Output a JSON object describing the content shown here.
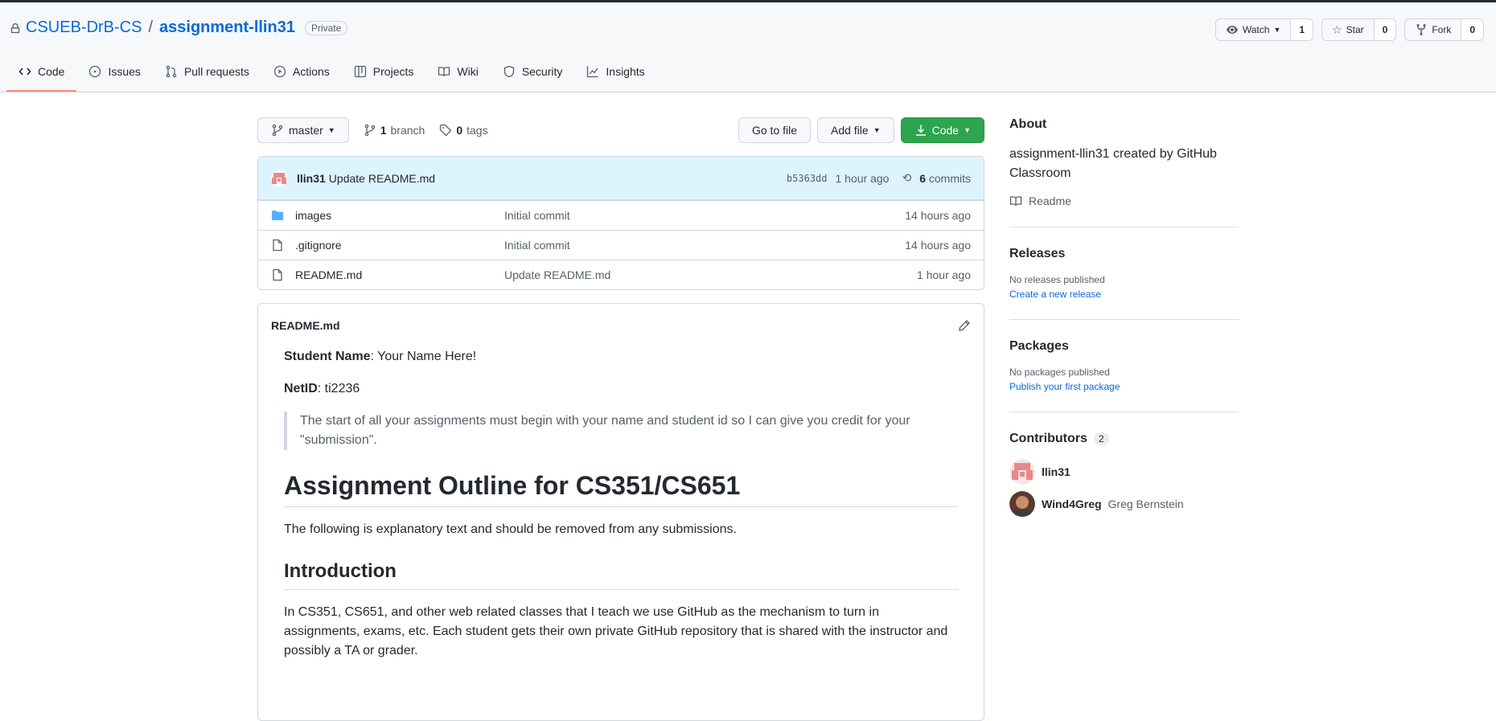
{
  "repo": {
    "owner": "CSUEB-DrB-CS",
    "separator": "/",
    "name": "assignment-llin31",
    "visibility": "Private"
  },
  "actions": {
    "watch_label": "Watch",
    "watch_count": "1",
    "star_label": "Star",
    "star_count": "0",
    "fork_label": "Fork",
    "fork_count": "0"
  },
  "tabs": [
    {
      "label": "Code",
      "icon": "code-icon"
    },
    {
      "label": "Issues",
      "icon": "issue-icon"
    },
    {
      "label": "Pull requests",
      "icon": "pull-request-icon"
    },
    {
      "label": "Actions",
      "icon": "play-icon"
    },
    {
      "label": "Projects",
      "icon": "table-icon"
    },
    {
      "label": "Wiki",
      "icon": "book-icon"
    },
    {
      "label": "Security",
      "icon": "shield-icon"
    },
    {
      "label": "Insights",
      "icon": "graph-icon"
    }
  ],
  "filebar": {
    "branch": "master",
    "branch_count": "1",
    "branch_word": "branch",
    "tag_count": "0",
    "tag_word": "tags",
    "goto_file": "Go to file",
    "add_file": "Add file",
    "code": "Code"
  },
  "commit": {
    "author": "llin31",
    "message": "Update README.md",
    "sha": "b5363dd",
    "age": "1 hour ago",
    "count": "6",
    "count_word": "commits"
  },
  "files": [
    {
      "type": "folder",
      "name": "images",
      "message": "Initial commit",
      "age": "14 hours ago"
    },
    {
      "type": "file",
      "name": ".gitignore",
      "message": "Initial commit",
      "age": "14 hours ago"
    },
    {
      "type": "file",
      "name": "README.md",
      "message": "Update README.md",
      "age": "1 hour ago"
    }
  ],
  "readme": {
    "filename": "README.md",
    "student_label": "Student Name",
    "student_value": ": Your Name Here!",
    "netid_label": "NetID",
    "netid_value": ": ti2236",
    "quote": "The start of all your assignments must begin with your name and student id so I can give you credit for your \"submission\".",
    "h1": "Assignment Outline for CS351/CS651",
    "p1": "The following is explanatory text and should be removed from any submissions.",
    "h2": "Introduction",
    "p2": "In CS351, CS651, and other web related classes that I teach we use GitHub as the mechanism to turn in assignments, exams, etc. Each student gets their own private GitHub repository that is shared with the instructor and possibly a TA or grader."
  },
  "sidebar": {
    "about_title": "About",
    "about_desc": "assignment-llin31 created by GitHub Classroom",
    "readme_link": "Readme",
    "releases_title": "Releases",
    "releases_none": "No releases published",
    "releases_link": "Create a new release",
    "packages_title": "Packages",
    "packages_none": "No packages published",
    "packages_link": "Publish your first package",
    "contributors_title": "Contributors",
    "contributors_count": "2",
    "contributors": [
      {
        "login": "llin31",
        "name": ""
      },
      {
        "login": "Wind4Greg",
        "name": "Greg Bernstein"
      }
    ]
  },
  "colors": {
    "link": "#0969da",
    "green_button": "#2da44e",
    "active_tab_underline": "#fd8c73",
    "commit_bar": "#ddf4ff"
  }
}
